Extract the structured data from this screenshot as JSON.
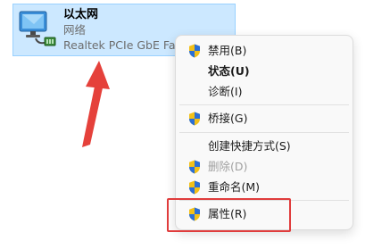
{
  "adapter": {
    "name": "以太网",
    "status": "网络",
    "device": "Realtek PCIe GbE Fam"
  },
  "context_menu": {
    "items": [
      {
        "label": "禁用(B)",
        "icon": "shield-icon",
        "style": "normal"
      },
      {
        "label": "状态(U)",
        "icon": "",
        "style": "bold"
      },
      {
        "label": "诊断(I)",
        "icon": "",
        "style": "normal"
      },
      {
        "label": "桥接(G)",
        "icon": "shield-icon",
        "style": "normal"
      },
      {
        "label": "创建快捷方式(S)",
        "icon": "",
        "style": "normal"
      },
      {
        "label": "删除(D)",
        "icon": "shield-icon",
        "style": "disabled"
      },
      {
        "label": "重命名(M)",
        "icon": "shield-icon",
        "style": "normal"
      },
      {
        "label": "属性(R)",
        "icon": "shield-icon",
        "style": "normal"
      }
    ]
  },
  "colors": {
    "selection_bg": "#cce8ff",
    "annotation_red": "#e03c3c",
    "shield_blue": "#2b6fd6",
    "shield_yellow": "#f2c018"
  }
}
